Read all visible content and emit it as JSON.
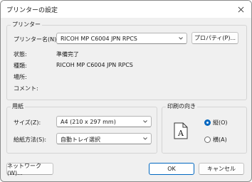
{
  "window": {
    "title": "プリンターの設定"
  },
  "printer": {
    "group_label": "プリンター",
    "name_label": "プリンター名(N):",
    "name_value": "RICOH MP C6004 JPN RPCS",
    "properties_button": "プロパティ(P)...",
    "status_label": "状態:",
    "status_value": "準備完了",
    "type_label": "種類:",
    "type_value": "RICOH MP C6004 JPN RPCS",
    "location_label": "場所:",
    "location_value": "",
    "comment_label": "コメント:",
    "comment_value": ""
  },
  "paper": {
    "group_label": "用紙",
    "size_label": "サイズ(Z):",
    "size_value": "A4 (210 x 297 mm)",
    "source_label": "給紙方法(S):",
    "source_value": "自動トレイ選択"
  },
  "orientation": {
    "group_label": "印刷の向き",
    "portrait_label": "縦(O)",
    "landscape_label": "横(A)",
    "selected": "portrait",
    "glyph": "A"
  },
  "footer": {
    "network_button": "ネットワーク(W)...",
    "ok_button": "OK",
    "cancel_button": "キャンセル"
  },
  "colors": {
    "accent": "#0067c0"
  }
}
